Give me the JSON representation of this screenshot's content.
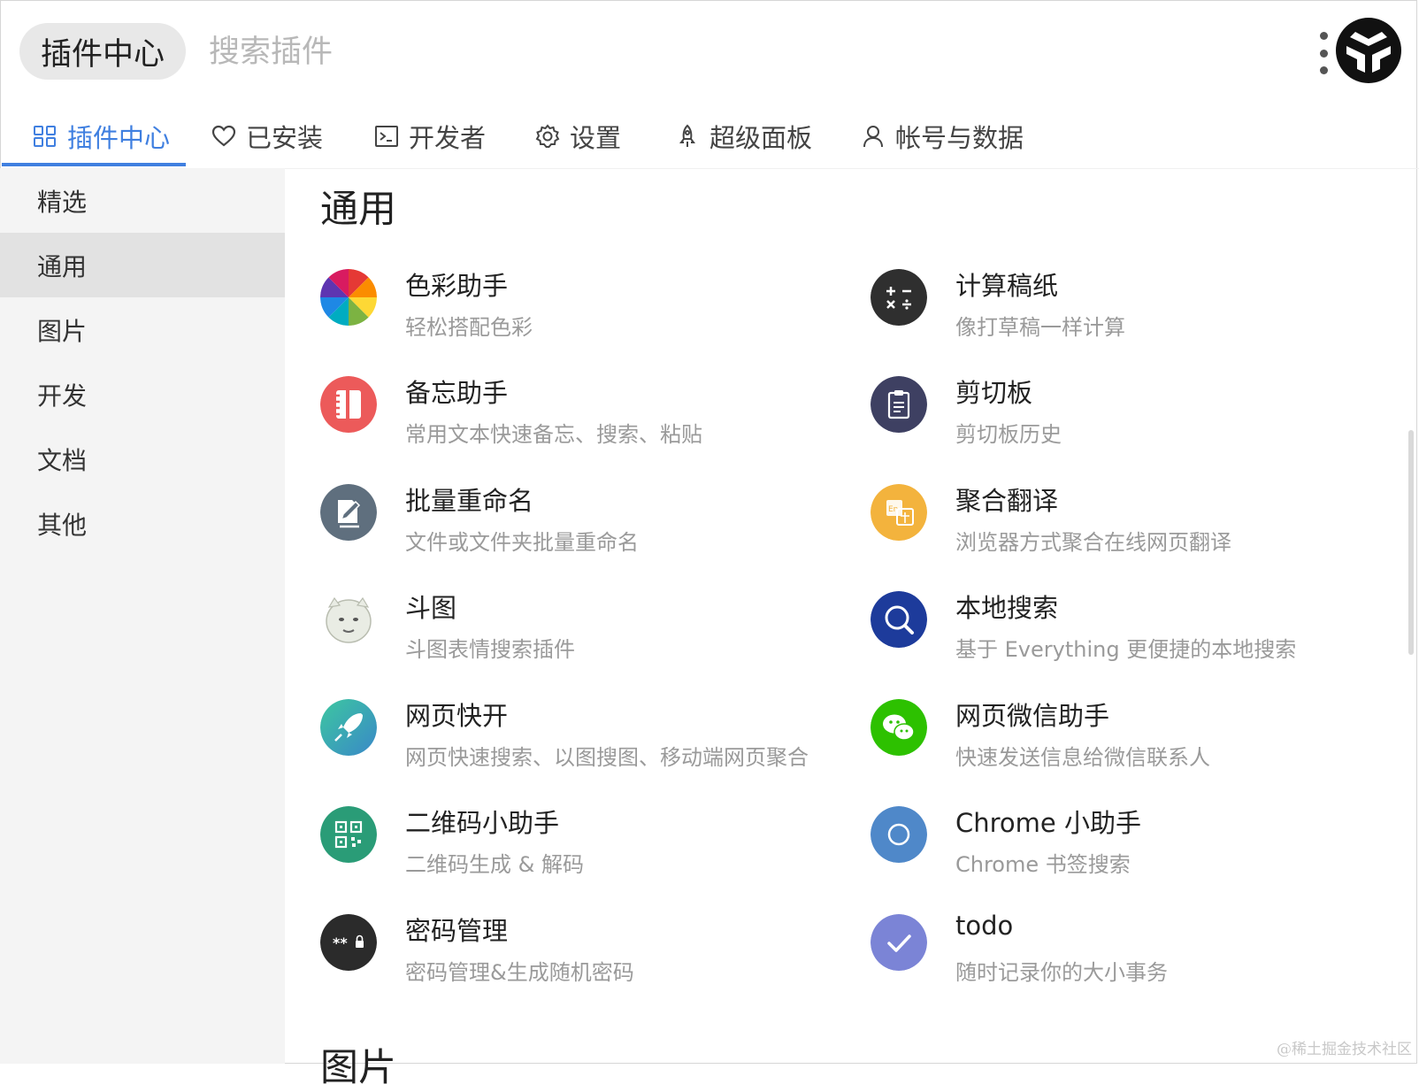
{
  "header": {
    "pill_label": "插件中心",
    "search_placeholder": "搜索插件"
  },
  "tabs": [
    {
      "label": "插件中心",
      "icon": "apps-grid-icon"
    },
    {
      "label": "已安装",
      "icon": "heart-icon"
    },
    {
      "label": "开发者",
      "icon": "terminal-icon"
    },
    {
      "label": "设置",
      "icon": "gear-icon"
    },
    {
      "label": "超级面板",
      "icon": "rocket-icon"
    },
    {
      "label": "帐号与数据",
      "icon": "user-icon"
    }
  ],
  "sidebar": {
    "items": [
      {
        "label": "精选"
      },
      {
        "label": "通用"
      },
      {
        "label": "图片"
      },
      {
        "label": "开发"
      },
      {
        "label": "文档"
      },
      {
        "label": "其他"
      }
    ]
  },
  "main": {
    "section_title": "通用",
    "next_section_title": "图片",
    "plugins": [
      {
        "name": "色彩助手",
        "desc": "轻松搭配色彩",
        "icon": "color-wheel-icon"
      },
      {
        "name": "计算稿纸",
        "desc": "像打草稿一样计算",
        "icon": "calculator-icon"
      },
      {
        "name": "备忘助手",
        "desc": "常用文本快速备忘、搜索、粘贴",
        "icon": "notebook-icon"
      },
      {
        "name": "剪切板",
        "desc": "剪切板历史",
        "icon": "clipboard-icon"
      },
      {
        "name": "批量重命名",
        "desc": "文件或文件夹批量重命名",
        "icon": "rename-icon"
      },
      {
        "name": "聚合翻译",
        "desc": "浏览器方式聚合在线网页翻译",
        "icon": "translate-icon"
      },
      {
        "name": "斗图",
        "desc": "斗图表情搜索插件",
        "icon": "meme-face-icon"
      },
      {
        "name": "本地搜索",
        "desc": "基于 Everything 更便捷的本地搜索",
        "icon": "magnifier-icon"
      },
      {
        "name": "网页快开",
        "desc": "网页快速搜索、以图搜图、移动端网页聚合",
        "icon": "rocket-launch-icon"
      },
      {
        "name": "网页微信助手",
        "desc": "快速发送信息给微信联系人",
        "icon": "wechat-icon"
      },
      {
        "name": "二维码小助手",
        "desc": "二维码生成 & 解码",
        "icon": "qrcode-icon"
      },
      {
        "name": "Chrome 小助手",
        "desc": "Chrome 书签搜索",
        "icon": "chrome-icon"
      },
      {
        "name": "密码管理",
        "desc": "密码管理&生成随机密码",
        "icon": "password-icon"
      },
      {
        "name": "todo",
        "desc": "随时记录你的大小事务",
        "icon": "check-icon"
      }
    ]
  },
  "watermark": "@稀土掘金技术社区",
  "colors": {
    "accent": "#3f7fe0",
    "sidebar_bg": "#f4f4f4",
    "sidebar_active": "#e2e2e2"
  }
}
